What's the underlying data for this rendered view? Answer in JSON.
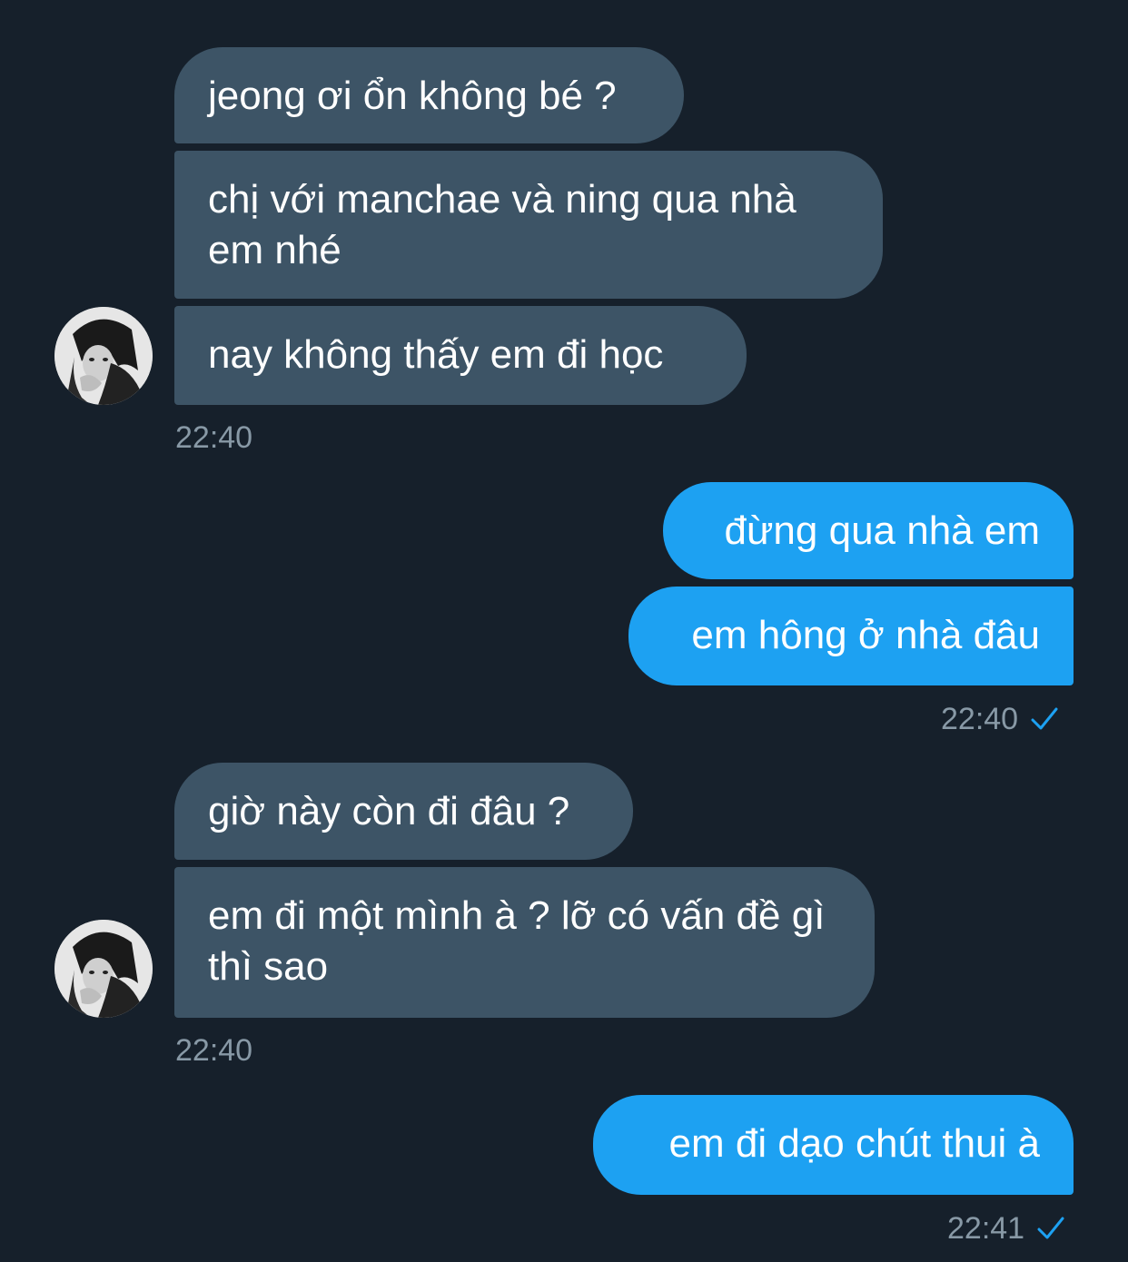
{
  "conversation": {
    "group1": {
      "messages": [
        "jeong ơi ổn không bé ?",
        "chị với manchae và ning qua nhà em nhé",
        "nay không thấy em đi học"
      ],
      "time": "22:40"
    },
    "group2": {
      "messages": [
        "đừng qua nhà em",
        "em hông ở nhà đâu"
      ],
      "time": "22:40"
    },
    "group3": {
      "messages": [
        "giờ này còn đi đâu ?",
        "em đi một mình à ? lỡ có vấn đề gì thì sao"
      ],
      "time": "22:40"
    },
    "group4": {
      "messages": [
        "em đi dạo chút thui à"
      ],
      "time": "22:41"
    }
  },
  "colors": {
    "background": "#16202b",
    "incoming_bubble": "#3d5466",
    "outgoing_bubble": "#1da1f2",
    "timestamp": "#8899a6",
    "read_check": "#1da1f2"
  },
  "icons": {
    "avatar": "contact-avatar",
    "read_receipt": "checkmark-icon"
  }
}
